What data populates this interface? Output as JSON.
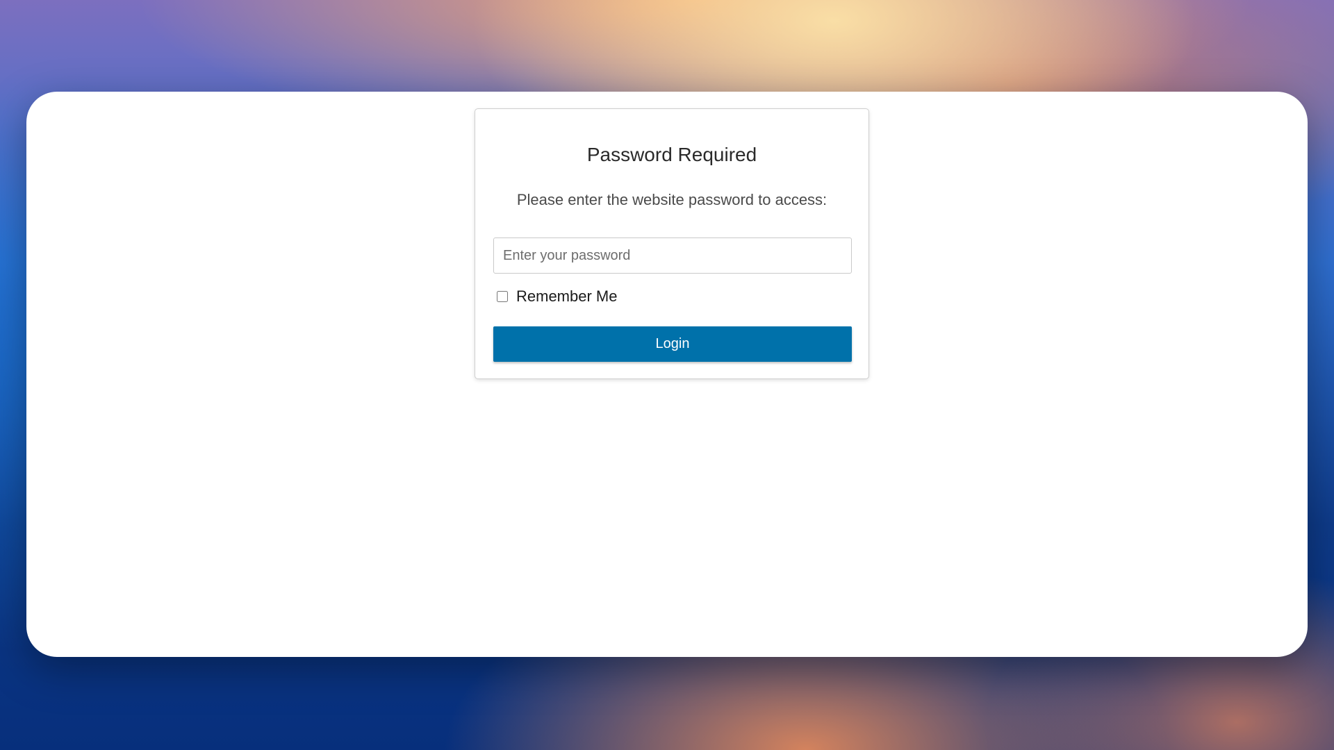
{
  "login": {
    "title": "Password Required",
    "subtitle": "Please enter the website password to access:",
    "password_placeholder": "Enter your password",
    "remember_label": "Remember Me",
    "remember_checked": false,
    "login_label": "Login"
  },
  "colors": {
    "login_button_bg": "#0071aa",
    "card_border": "#cfcfcf"
  }
}
